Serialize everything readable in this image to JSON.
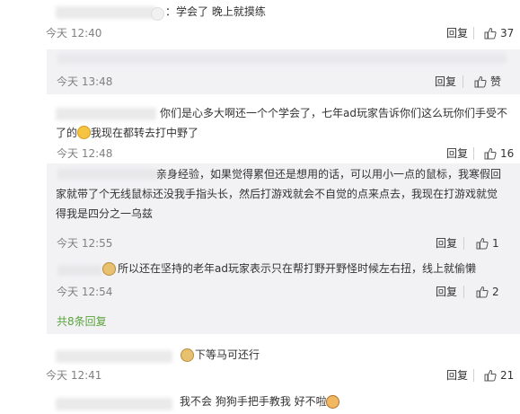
{
  "comments": [
    {
      "text_after": "：学会了 晚上就摸练",
      "time": "今天 12:40",
      "reply_label": "回复",
      "likes": "37"
    },
    {
      "time": "今天 13:48",
      "reply_label": "回复",
      "likes": "赞"
    },
    {
      "text_line1": "你们是心多大啊还一个个学会了，七年ad玩家告诉你们这么玩你们手受不",
      "text_line2_a": "了的",
      "text_line2_b": "我现在都转去打中野了",
      "time": "今天 12:48",
      "reply_label": "回复",
      "likes": "16"
    }
  ],
  "replies": [
    {
      "line1": "亲身经验，如果觉得累但还是想用的话，可以用小一点的鼠标，我寒假回",
      "line2": "家就带了个无线鼠标还没我手指头长，然后打游戏就会不自觉的点来点去，我现在打游戏就觉",
      "line3": "得我是四分之一乌兹",
      "time": "今天 12:55",
      "reply_label": "回复",
      "likes": "1"
    },
    {
      "text": "所以还在坚持的老年ad玩家表示只在帮打野开野怪时候左右扭，线上就偷懒",
      "time": "今天 12:54",
      "reply_label": "回复",
      "likes": "2"
    }
  ],
  "more_replies": "共8条回复",
  "comment4": {
    "text": "下等马可还行",
    "time": "今天 12:41",
    "reply_label": "回复",
    "likes": "21"
  },
  "comment5": {
    "text": "我不会 狗狗手把手教我 好不啦"
  },
  "colors": {
    "time": "#808080",
    "green_link": "#5aa33b",
    "panel": "#f2f2f5"
  }
}
